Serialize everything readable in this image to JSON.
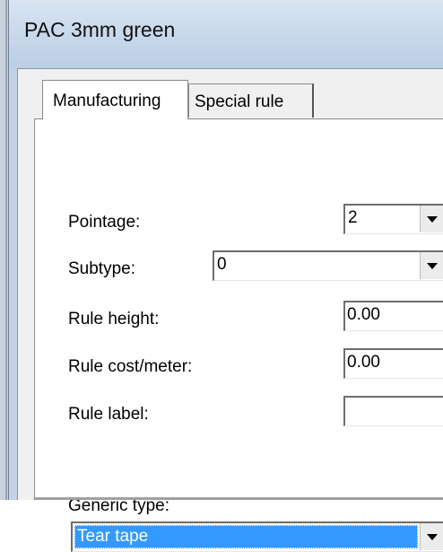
{
  "window": {
    "title": "PAC 3mm green"
  },
  "tabs": [
    {
      "label": "Manufacturing",
      "active": true
    },
    {
      "label": "Special rule",
      "active": false
    }
  ],
  "form": {
    "pointage": {
      "label": "Pointage:",
      "value": "2"
    },
    "subtype": {
      "label": "Subtype:",
      "value": "0"
    },
    "rule_height": {
      "label": "Rule height:",
      "value": "0.00"
    },
    "rule_cost": {
      "label": "Rule cost/meter:",
      "value": "0.00"
    },
    "rule_label": {
      "label": "Rule label:",
      "value": ""
    },
    "generic_type": {
      "label": "Generic type:",
      "value": "Tear tape"
    }
  },
  "icons": {
    "dropdown": "chevron-down-icon"
  },
  "colors": {
    "selection": "#3399ff",
    "titlebar": "#c5d6ea"
  }
}
